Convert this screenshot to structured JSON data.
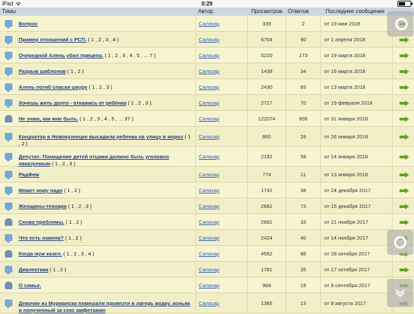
{
  "status": {
    "device": "iPad",
    "time": "0:29"
  },
  "headers": {
    "topics": "Темы",
    "author": "Автор",
    "views": "Просмотров",
    "answers": "Ответов",
    "last": "Последнее сообщение"
  },
  "rows": [
    {
      "title": "Вопрос",
      "pages": "",
      "author": "Салазар",
      "views": "339",
      "answers": "2",
      "date": "от 19 мая 2018",
      "icon": "comment-icon"
    },
    {
      "title": "Пример отношений с РСП.",
      "pages": "( 1 , 2 , 3 , 4 )",
      "author": "Салазар",
      "views": "6704",
      "answers": "90",
      "date": "от 1 апреля 2018",
      "icon": "comment-icon"
    },
    {
      "title": "Очередной Алень убил прицепа.",
      "pages": "( 1 , 2 , 3 , 4 , 5 , ... 7 )",
      "author": "Салазар",
      "views": "5220",
      "answers": "173",
      "date": "от 19 марта 2018",
      "icon": "comment-icon"
    },
    {
      "title": "Разрыв шаблонов",
      "pages": "( 1 , 2 )",
      "author": "Салазар",
      "views": "1438",
      "answers": "34",
      "date": "от 16 марта 2018",
      "icon": "comment-icon"
    },
    {
      "title": "Алень погиб спасая шкуру",
      "pages": "( 1 , 2 , 3 )",
      "author": "Салазар",
      "views": "2430",
      "answers": "65",
      "date": "от 13 марта 2018",
      "icon": "comment-icon"
    },
    {
      "title": "Хочешь жить долго - откажись от ребёнка",
      "pages": "( 1 , 2 , 3 )",
      "author": "Салазар",
      "views": "2717",
      "answers": "70",
      "date": "от 19 февраля 2018",
      "icon": "comment-icon"
    },
    {
      "title": "Не знаю, как мне быть.",
      "pages": "( 1 , 2 , 3 , 4 , 5 , ... 37 )",
      "author": "Салазар",
      "views": "122074",
      "answers": "906",
      "date": "от 31 января 2018",
      "icon": "lock-icon"
    },
    {
      "title": "Кондуктор в Новокузнецке высадила ребенка на улицу в мороз",
      "pages": "( 1 , 2 )",
      "author": "Салазар",
      "views": "860",
      "answers": "28",
      "date": "от 26 января 2018",
      "icon": "comment-icon",
      "tall": true
    },
    {
      "title": "Депутат: Похищение детей отцами должно быть уголовно наказуемым",
      "pages": "( 1 , 2 , 3 )",
      "author": "Салазар",
      "views": "2192",
      "answers": "58",
      "date": "от 14 января 2018",
      "icon": "comment-icon",
      "tall": true
    },
    {
      "title": "РадФем",
      "pages": "",
      "author": "Салазар",
      "views": "774",
      "answers": "11",
      "date": "от 13 января 2018",
      "icon": "comment-icon"
    },
    {
      "title": "Может кому надо",
      "pages": "( 1 , 2 )",
      "author": "Салазар",
      "views": "1742",
      "answers": "38",
      "date": "от 24 декабря 2017",
      "icon": "comment-icon"
    },
    {
      "title": "Женщины-технари",
      "pages": "( 1 , 2 , 3 )",
      "author": "Салазар",
      "views": "2682",
      "answers": "73",
      "date": "от 15 декабря 2017",
      "icon": "comment-icon"
    },
    {
      "title": "Снова проблемы.",
      "pages": "( 1 , 2 )",
      "author": "Салазар",
      "views": "2892",
      "answers": "33",
      "date": "от 21 ноября 2017",
      "icon": "lock-icon"
    },
    {
      "title": "Что есть измена?",
      "pages": "( 1 , 2 )",
      "author": "Салазар",
      "views": "2424",
      "answers": "40",
      "date": "от 14 ноября 2017",
      "icon": "comment-icon"
    },
    {
      "title": "Когда муж казел.",
      "pages": "( 1 , 2 , 3 , 4 )",
      "author": "Салазар",
      "views": "4562",
      "answers": "88",
      "date": "от 28 октября 2017",
      "icon": "lock-icon"
    },
    {
      "title": "Диалектика",
      "pages": "( 1 , 2 )",
      "author": "Салазар",
      "views": "1781",
      "answers": "35",
      "date": "от 17 октября 2017",
      "icon": "comment-icon"
    },
    {
      "title": "О семье.",
      "pages": "",
      "author": "Салазар",
      "views": "968",
      "answers": "18",
      "date": "от 8 сентября 2017",
      "icon": "lock-icon"
    },
    {
      "title": "Девочке из Мурманска помешали провезти в лагерь водку, коньяк и полученный за секс амфетамин",
      "pages": "",
      "author": "Салазар",
      "views": "1365",
      "answers": "13",
      "date": "от 8 августа 2017",
      "icon": "comment-icon",
      "tall": true
    }
  ]
}
